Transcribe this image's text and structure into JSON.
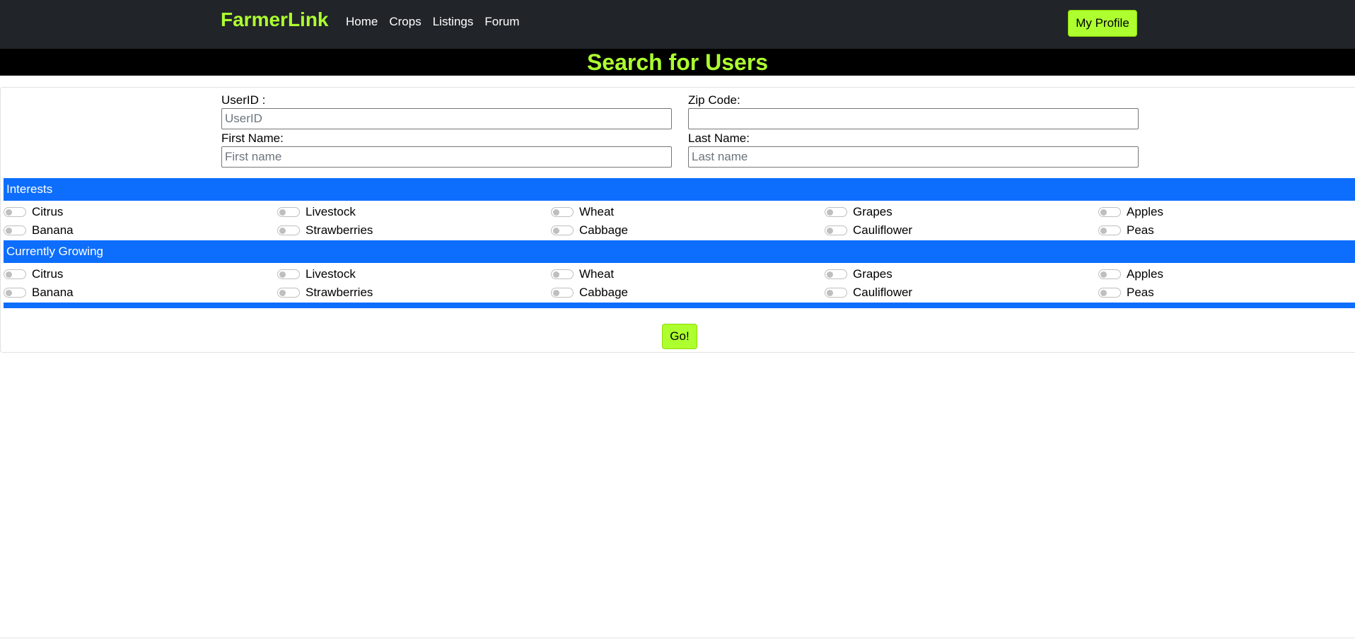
{
  "nav": {
    "brand": "FarmerLink",
    "links": [
      "Home",
      "Crops",
      "Listings",
      "Forum"
    ],
    "profile_label": "My Profile"
  },
  "page": {
    "title": "Search for Users"
  },
  "form": {
    "userid": {
      "label": "UserID :",
      "placeholder": "UserID",
      "value": ""
    },
    "zip": {
      "label": "Zip Code:",
      "placeholder": "",
      "value": ""
    },
    "first_name": {
      "label": "First Name:",
      "placeholder": "First name",
      "value": ""
    },
    "last_name": {
      "label": "Last Name:",
      "placeholder": "Last name",
      "value": ""
    },
    "submit_label": "Go!"
  },
  "interests": {
    "heading": "Interests",
    "items": [
      "Citrus",
      "Livestock",
      "Wheat",
      "Grapes",
      "Apples",
      "Banana",
      "Strawberries",
      "Cabbage",
      "Cauliflower",
      "Peas"
    ]
  },
  "growing": {
    "heading": "Currently Growing",
    "items": [
      "Citrus",
      "Livestock",
      "Wheat",
      "Grapes",
      "Apples",
      "Banana",
      "Strawberries",
      "Cabbage",
      "Cauliflower",
      "Peas"
    ]
  },
  "colors": {
    "accent": "#adff2f",
    "navbar": "#212529",
    "section": "#0d6efd"
  }
}
